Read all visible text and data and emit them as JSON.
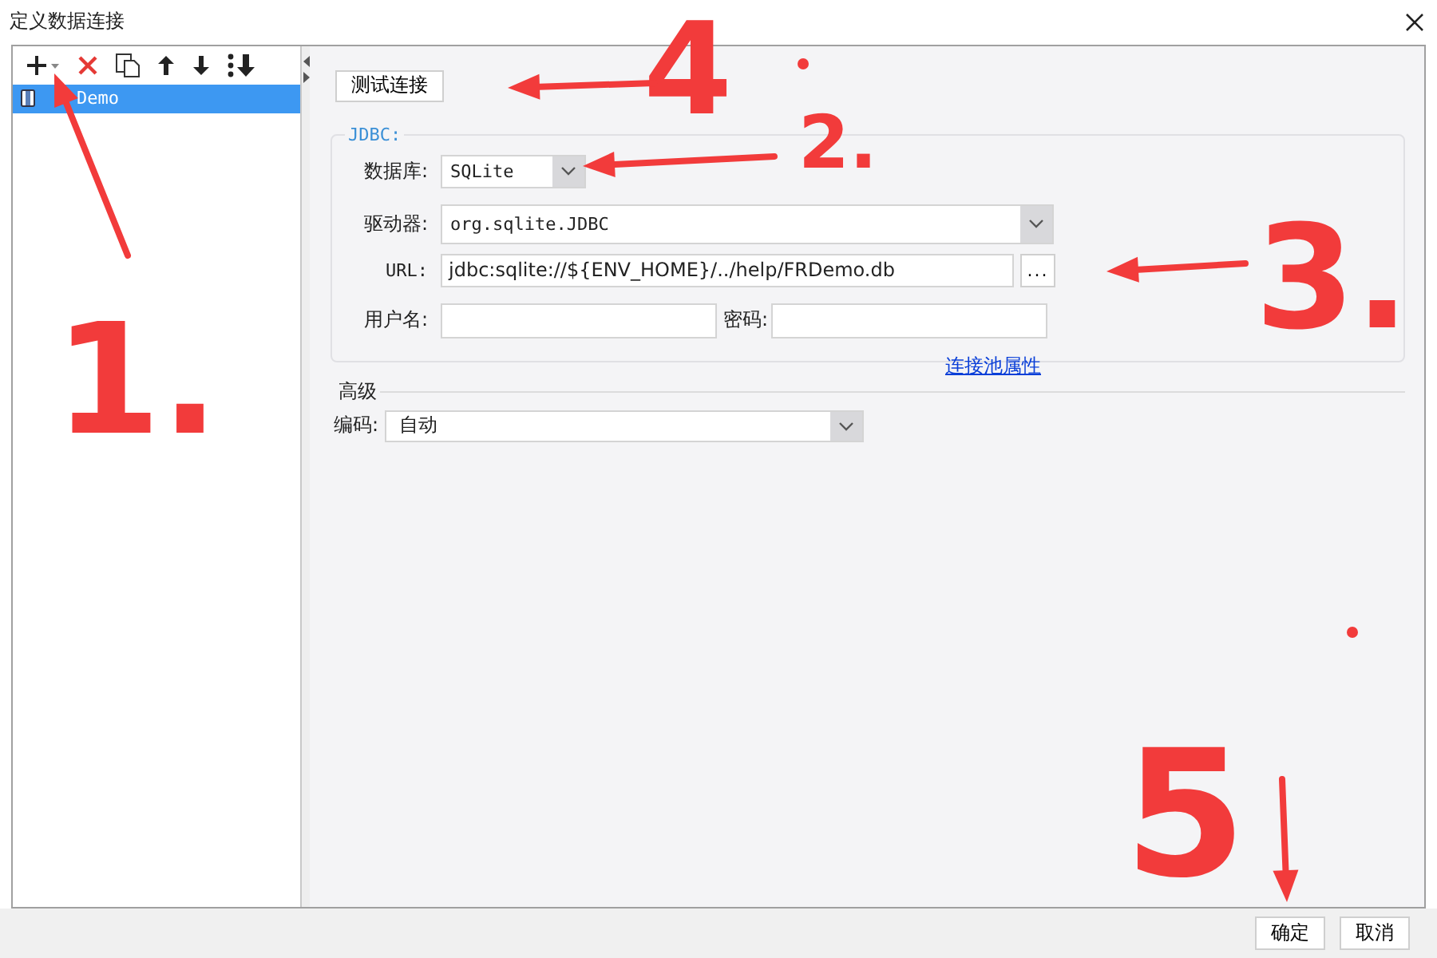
{
  "window": {
    "title": "定义数据连接"
  },
  "connections": [
    {
      "label": "Demo",
      "selected": true
    }
  ],
  "test_button": "测试连接",
  "jdbc": {
    "legend": "JDBC:",
    "database": {
      "label": "数据库:",
      "value": "SQLite"
    },
    "driver": {
      "label": "驱动器:",
      "value": "org.sqlite.JDBC"
    },
    "url": {
      "label": "URL:",
      "value": "jdbc:sqlite://${ENV_HOME}/../help/FRDemo.db",
      "browse": "..."
    },
    "username": {
      "label": "用户名:"
    },
    "password": {
      "label": "密码:"
    },
    "pool_link": "连接池属性"
  },
  "advanced": {
    "legend": "高级",
    "encoding": {
      "label": "编码:",
      "value": "自动"
    }
  },
  "buttons": [
    "确定",
    "取消"
  ],
  "annotations": [
    "1.",
    "2.",
    "3.",
    "4",
    "5"
  ]
}
